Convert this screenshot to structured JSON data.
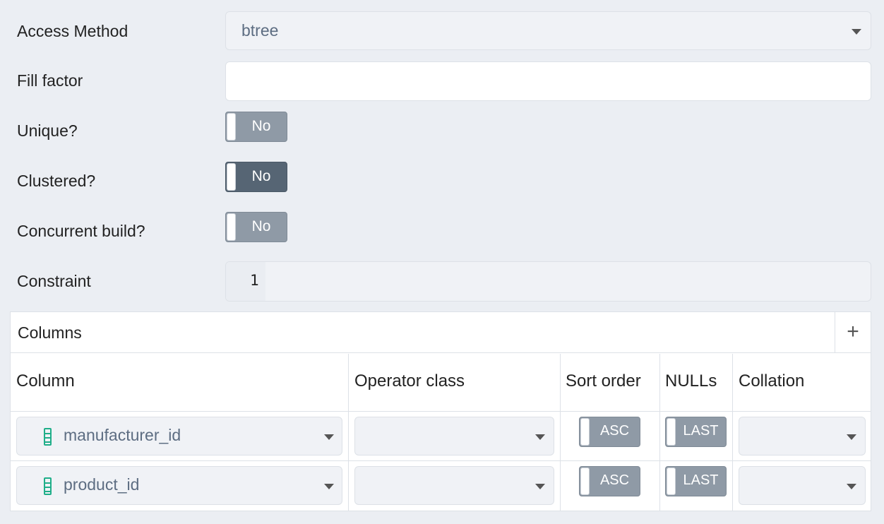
{
  "form": {
    "access_method": {
      "label": "Access Method",
      "value": "btree"
    },
    "fill_factor": {
      "label": "Fill factor",
      "value": ""
    },
    "unique": {
      "label": "Unique?",
      "value": "No"
    },
    "clustered": {
      "label": "Clustered?",
      "value": "No"
    },
    "concurrent_build": {
      "label": "Concurrent build?",
      "value": "No"
    },
    "constraint": {
      "label": "Constraint",
      "line_number": "1"
    }
  },
  "columns_grid": {
    "title": "Columns",
    "add_label": "+",
    "headers": [
      "Column",
      "Operator class",
      "Sort order",
      "NULLs",
      "Collation"
    ],
    "rows": [
      {
        "column": "manufacturer_id",
        "operator_class": "",
        "sort_order": "ASC",
        "nulls": "LAST",
        "collation": ""
      },
      {
        "column": "product_id",
        "operator_class": "",
        "sort_order": "ASC",
        "nulls": "LAST",
        "collation": ""
      }
    ]
  }
}
